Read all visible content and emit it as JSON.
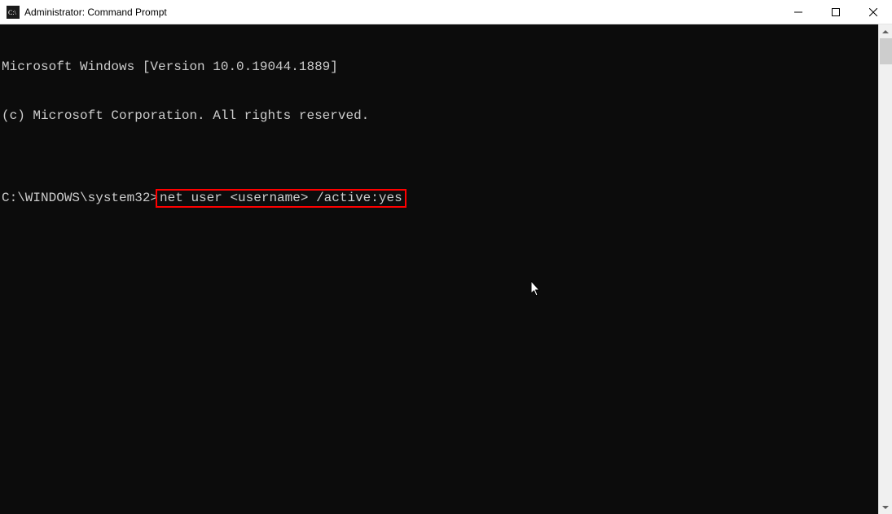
{
  "window": {
    "title": "Administrator: Command Prompt"
  },
  "console": {
    "line1": "Microsoft Windows [Version 10.0.19044.1889]",
    "line2": "(c) Microsoft Corporation. All rights reserved.",
    "blank": "",
    "prompt": "C:\\WINDOWS\\system32>",
    "command": "net user <username> /active:yes"
  },
  "icons": {
    "titlebar": "cmd-icon",
    "minimize": "minimize-icon",
    "maximize": "maximize-icon",
    "close": "close-icon",
    "scroll_up": "scroll-up-icon",
    "scroll_down": "scroll-down-icon"
  }
}
